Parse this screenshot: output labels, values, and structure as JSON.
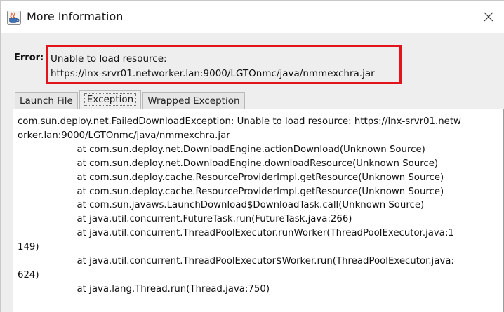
{
  "window": {
    "title": "More Information",
    "close_glyph": "✕"
  },
  "error": {
    "label": "Error:",
    "line1": "Unable to load resource:",
    "line2": "https://lnx-srvr01.networker.lan:9000/LGTOnmc/java/nmmexchra.jar",
    "highlight_color": "#e2131a"
  },
  "tabs": [
    {
      "label": "Launch File",
      "selected": false
    },
    {
      "label": "Exception",
      "selected": true
    },
    {
      "label": "Wrapped Exception",
      "selected": false
    }
  ],
  "stacktrace": [
    "com.sun.deploy.net.FailedDownloadException: Unable to load resource: https://lnx-srvr01.netw",
    "orker.lan:9000/LGTOnmc/java/nmmexchra.jar",
    "                    at com.sun.deploy.net.DownloadEngine.actionDownload(Unknown Source)",
    "                    at com.sun.deploy.net.DownloadEngine.downloadResource(Unknown Source)",
    "                    at com.sun.deploy.cache.ResourceProviderImpl.getResource(Unknown Source)",
    "                    at com.sun.deploy.cache.ResourceProviderImpl.getResource(Unknown Source)",
    "                    at com.sun.javaws.LaunchDownload$DownloadTask.call(Unknown Source)",
    "                    at java.util.concurrent.FutureTask.run(FutureTask.java:266)",
    "                    at java.util.concurrent.ThreadPoolExecutor.runWorker(ThreadPoolExecutor.java:1",
    "149)",
    "                    at java.util.concurrent.ThreadPoolExecutor$Worker.run(ThreadPoolExecutor.java:",
    "624)",
    "                    at java.lang.Thread.run(Thread.java:750)"
  ],
  "icons": {
    "app": "java-cup-icon",
    "close": "close-icon"
  }
}
